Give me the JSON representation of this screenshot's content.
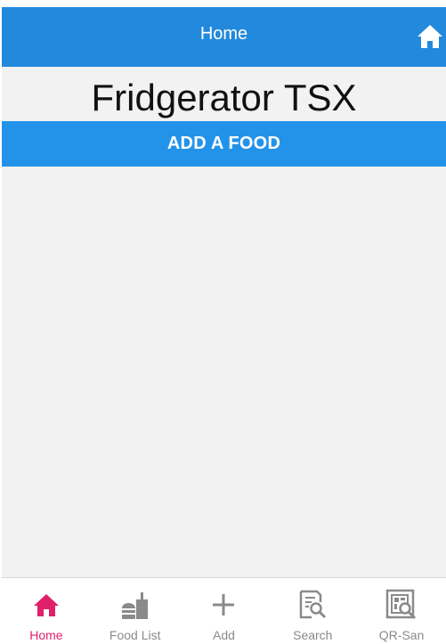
{
  "header": {
    "title": "Home"
  },
  "app": {
    "title": "Fridgerator TSX"
  },
  "main": {
    "add_button_label": "ADD A FOOD"
  },
  "tabs": [
    {
      "label": "Home",
      "icon": "home-icon",
      "active": true
    },
    {
      "label": "Food List",
      "icon": "food-icon",
      "active": false
    },
    {
      "label": "Add",
      "icon": "plus-icon",
      "active": false
    },
    {
      "label": "Search",
      "icon": "search-document-icon",
      "active": false
    },
    {
      "label": "QR-San",
      "icon": "qr-scan-icon",
      "active": false
    }
  ],
  "colors": {
    "header": "#2289dc",
    "button": "#2393ea",
    "active_tab": "#e0206a",
    "inactive_tab": "#8a8a8a",
    "background": "#f2f2f2"
  }
}
